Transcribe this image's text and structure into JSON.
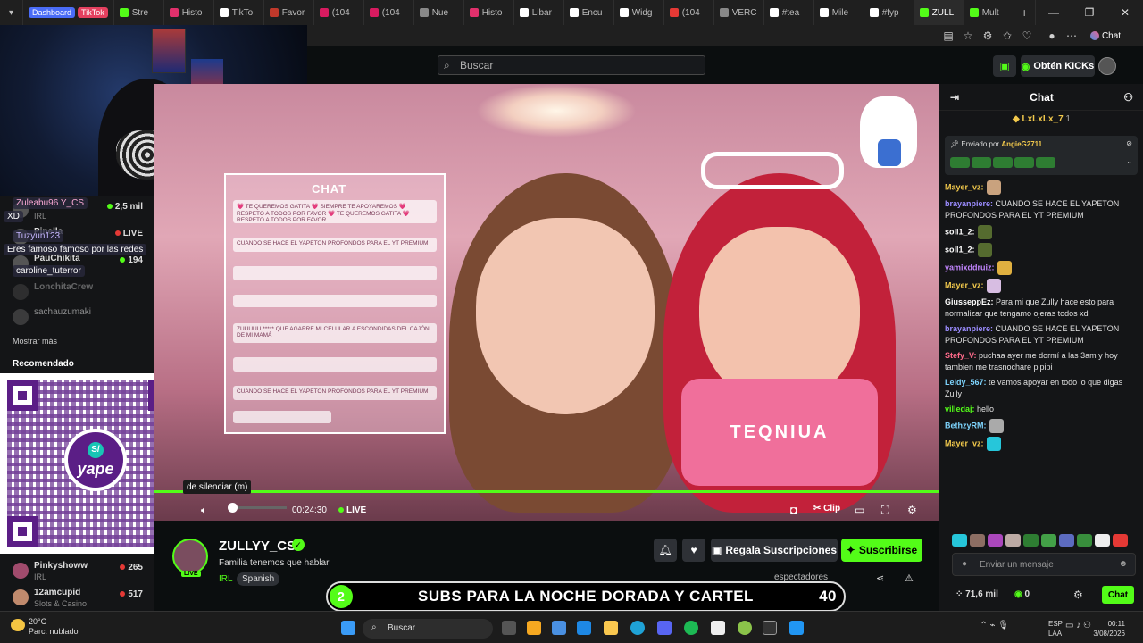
{
  "browser": {
    "tabs": [
      {
        "label": "Stre",
        "color": "#53fc18"
      },
      {
        "label": "Histo",
        "color": "#e1306c"
      },
      {
        "label": "TikTo",
        "color": "#ffffff"
      },
      {
        "label": "Favor",
        "color": "#c0392b"
      },
      {
        "label": "(104",
        "color": "#d81b60"
      },
      {
        "label": "(104",
        "color": "#d81b60"
      },
      {
        "label": "Nue",
        "color": "#888888"
      },
      {
        "label": "Histo",
        "color": "#e1306c"
      },
      {
        "label": "Libar",
        "color": "#ffffff"
      },
      {
        "label": "Encu",
        "color": "#ffffff"
      },
      {
        "label": "Widg",
        "color": "#ffffff"
      },
      {
        "label": "(104",
        "color": "#e53935"
      },
      {
        "label": "VERC",
        "color": "#888888"
      },
      {
        "label": "#tea",
        "color": "#ffffff"
      },
      {
        "label": "Mile",
        "color": "#ffffff"
      },
      {
        "label": "#fyp",
        "color": "#ffffff"
      },
      {
        "label": "ZULL",
        "color": "#53fc18",
        "active": true
      },
      {
        "label": "Mult",
        "color": "#53fc18"
      }
    ],
    "chip_dashboard": "Dashboard",
    "chip_tiktok": "TikTok",
    "copilot_label": "Chat"
  },
  "header": {
    "search_placeholder": "Buscar",
    "kicks_label": "Obtén KICKs"
  },
  "sidebar": {
    "overlay": [
      {
        "user": "Zuleabu96",
        "rest": "Y_CS"
      },
      {
        "user": "XD",
        "rest": ""
      },
      {
        "user": "Tuzyun123",
        "rest": ""
      },
      {
        "user": "Eres famoso famoso por las redes",
        "rest": ""
      },
      {
        "user": "caroline_tuterror",
        "rest": ""
      }
    ],
    "rows_top": [
      {
        "name": "2,5 mil",
        "cat": "IRL",
        "viewers": "2,5 mil"
      },
      {
        "name": "Pinella",
        "cat": "",
        "viewers": "LIVE"
      },
      {
        "name": "PauChikita",
        "cat": "",
        "viewers": "194"
      },
      {
        "name": "LonchitaCrew",
        "cat": "",
        "viewers": ""
      },
      {
        "name": "sachauzumaki",
        "cat": "",
        "viewers": ""
      }
    ],
    "show_more": "Mostrar más",
    "recommended": "Recomendado",
    "rows_bottom": [
      {
        "name": "Pinkyshoww",
        "cat": "IRL",
        "viewers": "265"
      },
      {
        "name": "12amcupid",
        "cat": "Slots & Casino",
        "viewers": "517"
      }
    ],
    "qr_brand": "yape"
  },
  "video": {
    "chat_overlay_title": "CHAT",
    "chat_overlay_msgs": [
      "💗 TE QUEREMOS GATITA 💗 SIEMPRE TE APOYAREMOS 💗 RESPETO A TODOS POR FAVOR 💗 TE QUEREMOS GATITA 💗 RESPETO A TODOS POR FAVOR",
      "CUANDO SE HACE EL YAPETON PROFONDOS PARA EL YT PREMIUM",
      "",
      "",
      "ZUUUUU ***** QUE AGARRE MI CELULAR A ESCONDIDAS DEL CAJÓN DE MI MAMÁ",
      "",
      "CUANDO SE HACE EL YAPETON PROFONDOS PARA EL YT PREMIUM",
      ""
    ],
    "shirt_text": "TEQNIUA",
    "tooltip": "de silenciar (m)",
    "time": "00:24:30",
    "live": "LIVE",
    "clip": "Clip"
  },
  "stream": {
    "channel": "ZULLYY_CS",
    "live_badge": "LIVE",
    "title": "Familia tenemos que hablar",
    "category": "IRL",
    "language": "Spanish",
    "gift_subs": "Regala Suscripciones",
    "subscribe": "Suscribirse",
    "viewers_label": "espectadores"
  },
  "banner": {
    "left": "2",
    "text": "SUBS PARA LA NOCHE DORADA Y CARTEL",
    "right": "40"
  },
  "chat": {
    "title": "Chat",
    "top_gifter": "LxLxLx_7",
    "top_gifter_count": "1",
    "pinned_by_label": "Enviado por",
    "pinned_by": "AngieG2711",
    "messages": [
      {
        "user": "Mayer_vz:",
        "color": "#f2c94c",
        "text": ""
      },
      {
        "user": "brayanpiere:",
        "color": "#9b8cff",
        "text": "CUANDO SE HACE EL YAPETON PROFONDOS PARA EL YT PREMIUM"
      },
      {
        "user": "soll1_2:",
        "color": "#ffffff",
        "text": ""
      },
      {
        "user": "soll1_2:",
        "color": "#ffffff",
        "text": ""
      },
      {
        "user": "yamixddruiz:",
        "color": "#c084fc",
        "text": ""
      },
      {
        "user": "Mayer_vz:",
        "color": "#f2c94c",
        "text": ""
      },
      {
        "user": "GiusseppEz:",
        "color": "#ffffff",
        "text": "Para mi que Zully hace esto para normalizar que tengamo ojeras todos xd"
      },
      {
        "user": "brayanpiere:",
        "color": "#9b8cff",
        "text": "CUANDO SE HACE EL YAPETON PROFONDOS PARA EL YT PREMIUM"
      },
      {
        "user": "Stefy_V:",
        "color": "#ff6b8b",
        "text": "puchaa ayer me dormí a las 3am y hoy tambien me trasnochare pipipi"
      },
      {
        "user": "Leidy_567:",
        "color": "#7dd3fc",
        "text": "te vamos apoyar en todo lo que digas Zully"
      },
      {
        "user": "villedaj:",
        "color": "#53fc18",
        "text": "hello"
      },
      {
        "user": "BethzyRM:",
        "color": "#7dd3fc",
        "text": ""
      },
      {
        "user": "Mayer_vz:",
        "color": "#f2c94c",
        "text": ""
      }
    ],
    "input_placeholder": "Enviar un mensaje",
    "points": "71,6 mil",
    "kicks": "0",
    "send": "Chat"
  },
  "taskbar": {
    "temp": "20°C",
    "weather": "Parc. nublado",
    "search": "Buscar",
    "lang1": "ESP",
    "lang2": "LAA",
    "time": "00:11",
    "date": "3/08/2026"
  }
}
